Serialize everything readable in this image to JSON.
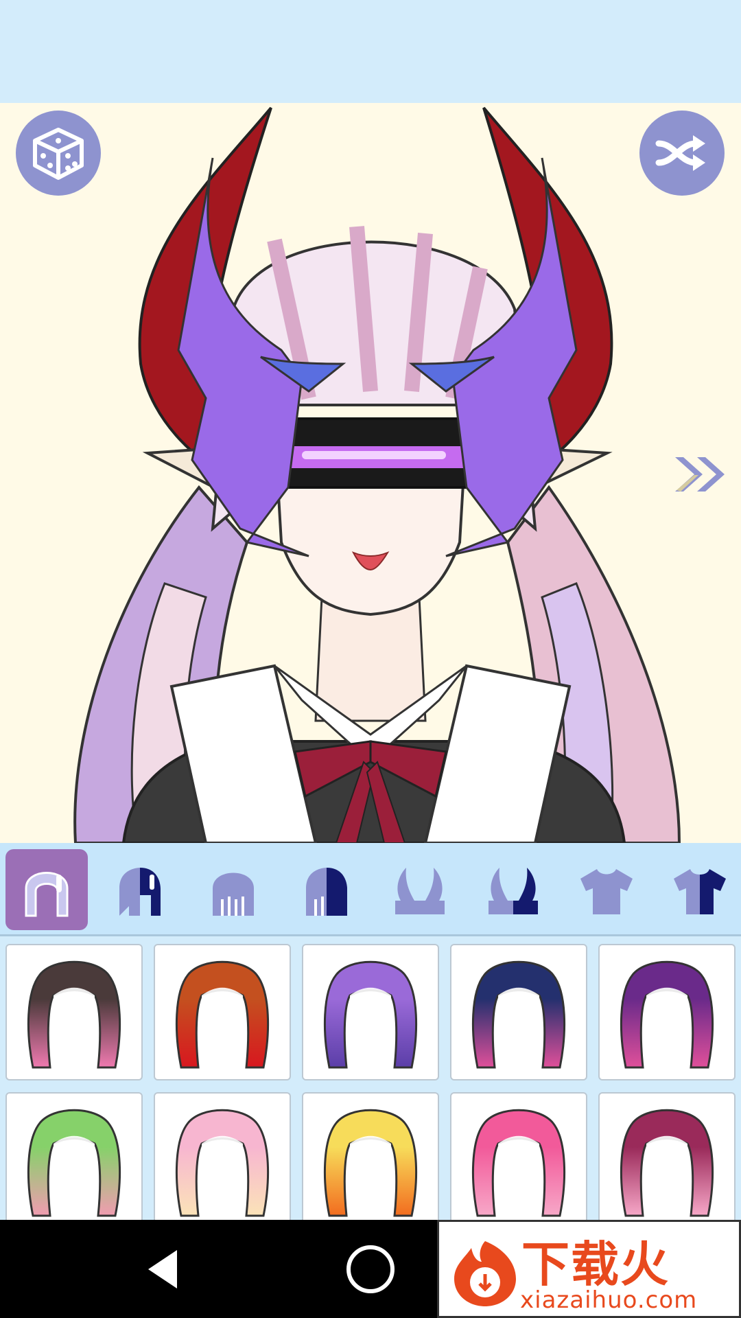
{
  "app": {
    "accent_color": "#8e93cf",
    "active_tab_color": "#9b6fb6",
    "tabbar_color": "#c6e6fb",
    "stage_color": "#fffae7"
  },
  "toolbar": {
    "random_icon": "dice-icon",
    "shuffle_icon": "shuffle-icon",
    "next_icon": "double-chevron-right-icon"
  },
  "tabs": [
    {
      "icon": "hair-front-icon",
      "active": true
    },
    {
      "icon": "hair-front-color-icon",
      "active": false
    },
    {
      "icon": "hair-back-icon",
      "active": false
    },
    {
      "icon": "hair-back-color-icon",
      "active": false
    },
    {
      "icon": "horns-icon",
      "active": false
    },
    {
      "icon": "horns-color-icon",
      "active": false
    },
    {
      "icon": "shirt-icon",
      "active": false
    },
    {
      "icon": "shirt-color-icon",
      "active": false
    }
  ],
  "hair_options": [
    {
      "icon": "hair-option-icon",
      "top_color": "#4a3a3a",
      "bottom_color": "#f07ab0"
    },
    {
      "icon": "hair-option-icon",
      "top_color": "#c4501f",
      "bottom_color": "#d8171f"
    },
    {
      "icon": "hair-option-icon",
      "top_color": "#9a6ad8",
      "bottom_color": "#5b3ea8"
    },
    {
      "icon": "hair-option-icon",
      "top_color": "#24306e",
      "bottom_color": "#e0509a"
    },
    {
      "icon": "hair-option-icon",
      "top_color": "#6a2a8a",
      "bottom_color": "#e0509a"
    },
    {
      "icon": "hair-option-icon",
      "top_color": "#86d16a",
      "bottom_color": "#f09cb0"
    },
    {
      "icon": "hair-option-icon",
      "top_color": "#f7b6d0",
      "bottom_color": "#fbe3b8"
    },
    {
      "icon": "hair-option-icon",
      "top_color": "#f7dc5a",
      "bottom_color": "#f26c1f"
    },
    {
      "icon": "hair-option-icon",
      "top_color": "#f25a9a",
      "bottom_color": "#f7a8c8"
    },
    {
      "icon": "hair-option-icon",
      "top_color": "#9a2a5a",
      "bottom_color": "#f7a8c8"
    }
  ],
  "navbar": {
    "back_icon": "back-triangle-icon",
    "home_icon": "home-circle-icon"
  },
  "watermark": {
    "title": "下载火",
    "url": "xiazaihuo.com"
  }
}
